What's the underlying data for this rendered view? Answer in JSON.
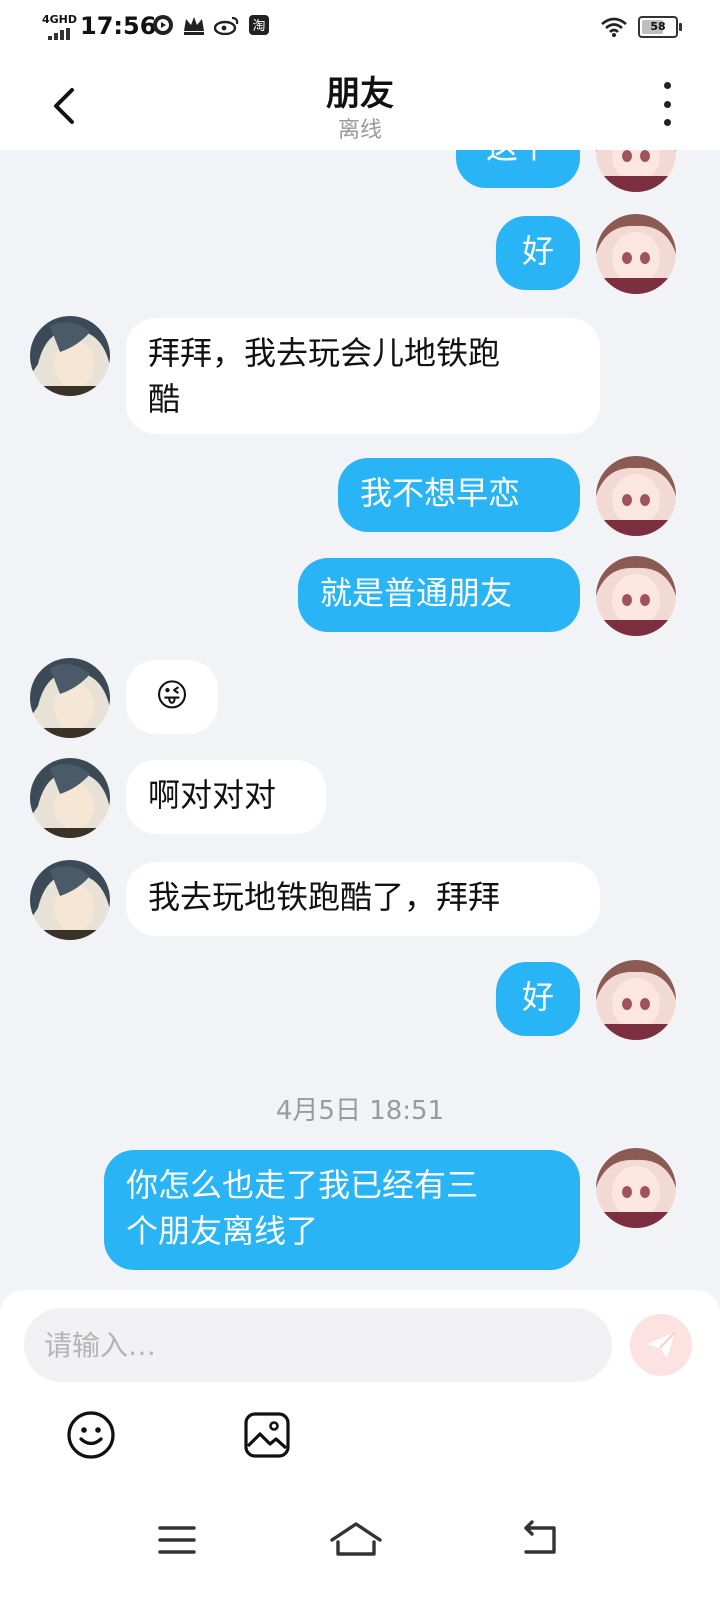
{
  "status_bar": {
    "network": "4GHD",
    "time": "17:56",
    "battery": "58",
    "battery_level": 0.58,
    "icons": [
      "play-icon",
      "crown-icon",
      "weibo-icon",
      "taobao-icon",
      "wifi-icon",
      "battery-icon"
    ]
  },
  "header": {
    "title": "朋友",
    "subtitle": "离线"
  },
  "messages": [
    {
      "side": "me",
      "text": "这个"
    },
    {
      "side": "me",
      "text": "好"
    },
    {
      "side": "them",
      "line1": "拜拜，我去玩会儿地铁跑",
      "line2": "酷"
    },
    {
      "side": "me",
      "text": "我不想早恋"
    },
    {
      "side": "me",
      "text": "就是普通朋友"
    },
    {
      "side": "them",
      "text": "😜"
    },
    {
      "side": "them",
      "text": "啊对对对"
    },
    {
      "side": "them",
      "text": "我去玩地铁跑酷了，拜拜"
    },
    {
      "side": "me",
      "text": "好"
    },
    {
      "side": "me",
      "line1": "你怎么也走了我已经有三",
      "line2": "个朋友离线了"
    }
  ],
  "timestamp": "4月5日 18:51",
  "composer": {
    "placeholder": "请输入…"
  },
  "colors": {
    "my_bubble": "#29b4f6",
    "their_bubble": "#ffffff",
    "background": "#f2f3f7",
    "send_button": "#fde2e2"
  }
}
